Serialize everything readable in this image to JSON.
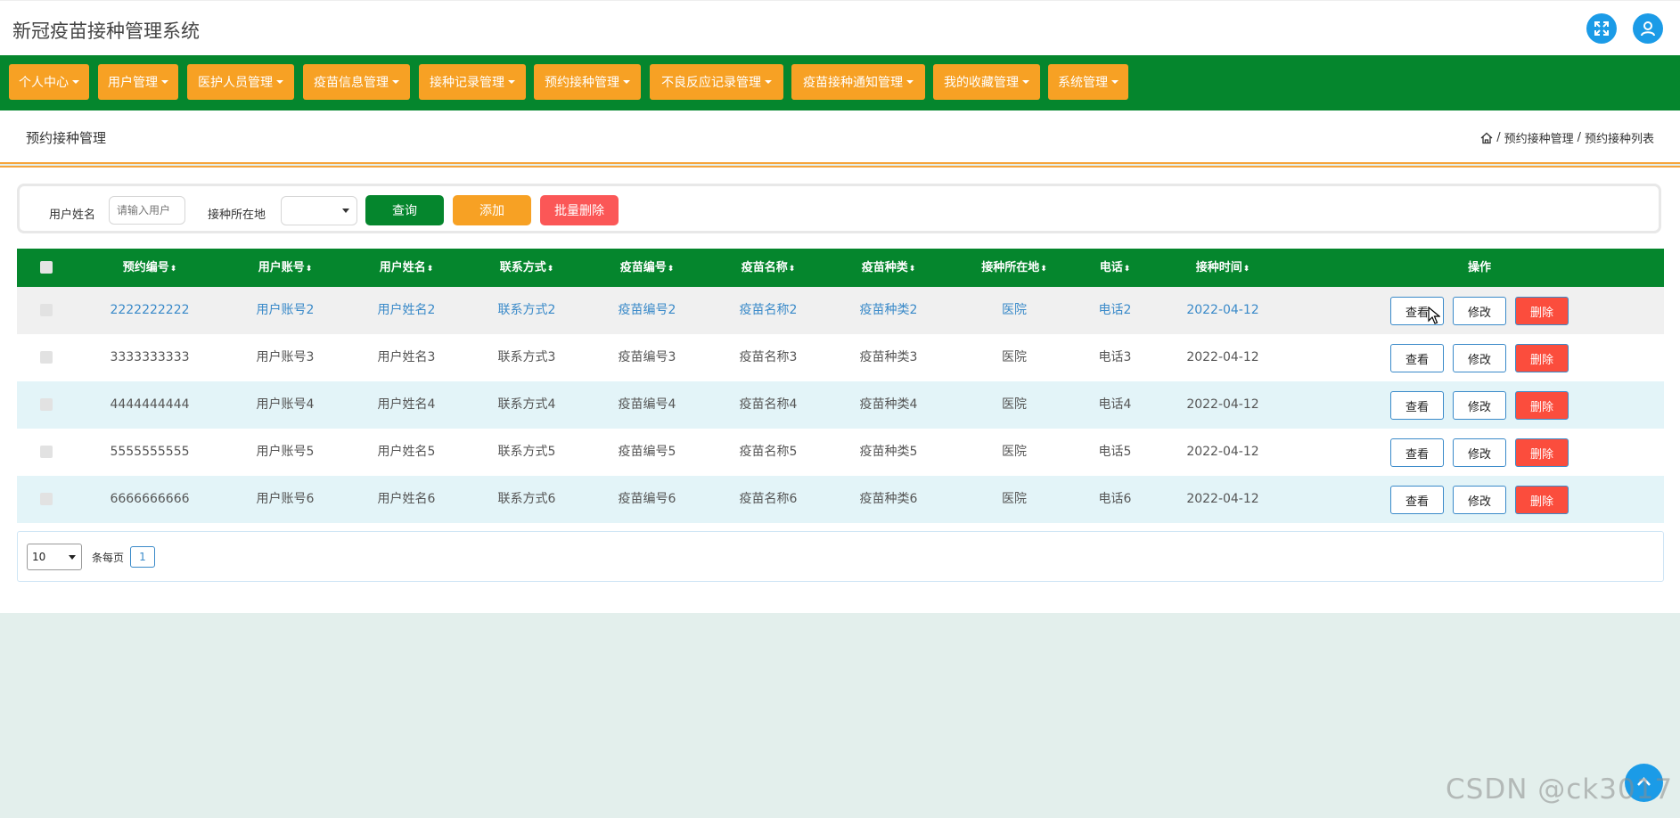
{
  "header": {
    "title": "新冠疫苗接种管理系统",
    "fullscreen_icon": "fullscreen-icon",
    "user_icon": "user-icon",
    "accent_color": "#1b9be7"
  },
  "nav": {
    "bar_color": "#05862d",
    "item_color": "#f7a124",
    "items": [
      {
        "label": "个人中心"
      },
      {
        "label": "用户管理"
      },
      {
        "label": "医护人员管理"
      },
      {
        "label": "疫苗信息管理"
      },
      {
        "label": "接种记录管理"
      },
      {
        "label": "预约接种管理"
      },
      {
        "label": "不良反应记录管理"
      },
      {
        "label": "疫苗接种通知管理"
      },
      {
        "label": "我的收藏管理"
      },
      {
        "label": "系统管理"
      }
    ]
  },
  "breadcrumb": {
    "page_title": "预约接种管理",
    "home_icon": "home-icon",
    "separator": "/",
    "level1": "预约接种管理",
    "level2": "预约接种列表"
  },
  "search": {
    "name_label": "用户姓名",
    "name_placeholder": "请输入用户",
    "location_label": "接种所在地",
    "location_value": "",
    "query_label": "查询",
    "add_label": "添加",
    "batch_delete_label": "批量删除",
    "query_color": "#05862d",
    "add_color": "#f7a124",
    "batch_delete_color": "#fb5757"
  },
  "table": {
    "columns": [
      "预约编号",
      "用户账号",
      "用户姓名",
      "联系方式",
      "疫苗编号",
      "疫苗名称",
      "疫苗种类",
      "接种所在地",
      "电话",
      "接种时间",
      "操作"
    ],
    "sort_icon": "sort-icon",
    "rows": [
      {
        "id": "2222222222",
        "account": "用户账号2",
        "name": "用户姓名2",
        "contact": "联系方式2",
        "vaccine_no": "疫苗编号2",
        "vaccine_name": "疫苗名称2",
        "vaccine_type": "疫苗种类2",
        "location": "医院",
        "phone": "电话2",
        "time": "2022-04-12"
      },
      {
        "id": "3333333333",
        "account": "用户账号3",
        "name": "用户姓名3",
        "contact": "联系方式3",
        "vaccine_no": "疫苗编号3",
        "vaccine_name": "疫苗名称3",
        "vaccine_type": "疫苗种类3",
        "location": "医院",
        "phone": "电话3",
        "time": "2022-04-12"
      },
      {
        "id": "4444444444",
        "account": "用户账号4",
        "name": "用户姓名4",
        "contact": "联系方式4",
        "vaccine_no": "疫苗编号4",
        "vaccine_name": "疫苗名称4",
        "vaccine_type": "疫苗种类4",
        "location": "医院",
        "phone": "电话4",
        "time": "2022-04-12"
      },
      {
        "id": "5555555555",
        "account": "用户账号5",
        "name": "用户姓名5",
        "contact": "联系方式5",
        "vaccine_no": "疫苗编号5",
        "vaccine_name": "疫苗名称5",
        "vaccine_type": "疫苗种类5",
        "location": "医院",
        "phone": "电话5",
        "time": "2022-04-12"
      },
      {
        "id": "6666666666",
        "account": "用户账号6",
        "name": "用户姓名6",
        "contact": "联系方式6",
        "vaccine_no": "疫苗编号6",
        "vaccine_name": "疫苗名称6",
        "vaccine_type": "疫苗种类6",
        "location": "医院",
        "phone": "电话6",
        "time": "2022-04-12"
      }
    ],
    "actions": {
      "view": "查看",
      "edit": "修改",
      "delete": "删除"
    },
    "row_colors": [
      "#f0f0f0",
      "#ffffff",
      "#e3f4f8",
      "#ffffff",
      "#e3f4f8"
    ],
    "highlight_text_color": "#3a8ac9",
    "normal_text_color": "#555555"
  },
  "pager": {
    "page_size": "10",
    "per_page_label": "条每页",
    "current_page": "1"
  },
  "watermark": "CSDN @ck3017",
  "float_button_icon": "arrow-up-icon"
}
